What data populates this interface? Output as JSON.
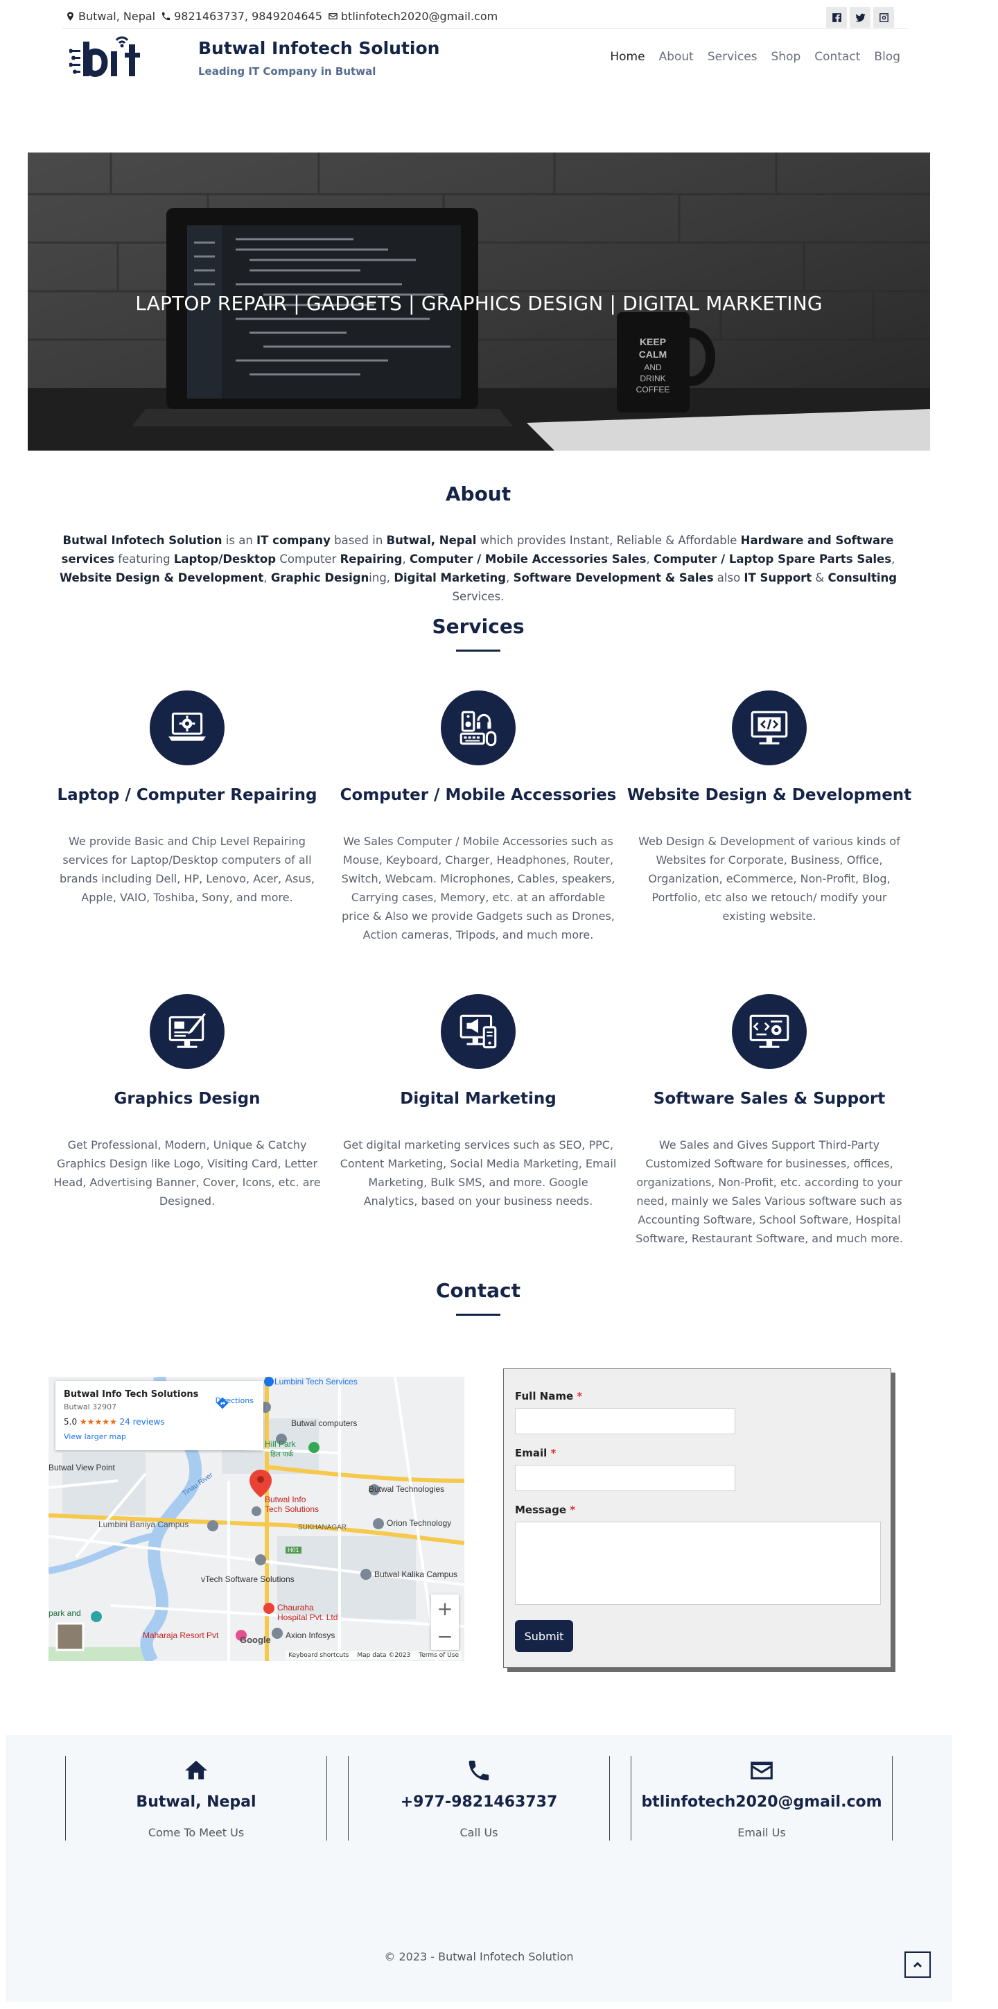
{
  "topbar": {
    "location": "Butwal, Nepal",
    "phones": "9821463737, 9849204645",
    "email": "btlinfotech2020@gmail.com",
    "social": [
      "facebook-icon",
      "twitter-icon",
      "instagram-icon"
    ]
  },
  "header": {
    "logo_text": "bit",
    "brand_name": "Butwal Infotech Solution",
    "tagline": "Leading IT Company in Butwal",
    "nav": [
      "Home",
      "About",
      "Services",
      "Shop",
      "Contact",
      "Blog"
    ],
    "active_nav": "Home"
  },
  "hero": {
    "caption": "LAPTOP REPAIR | GADGETS | GRAPHICS DESIGN | DIGITAL MARKETING",
    "mug_text": [
      "KEEP",
      "CALM",
      "AND",
      "DRINK",
      "COFFEE"
    ]
  },
  "about": {
    "heading": "About",
    "parts": [
      [
        "b",
        "Butwal Infotech Solution"
      ],
      [
        "t",
        " is an "
      ],
      [
        "b",
        "IT company"
      ],
      [
        "t",
        " based in "
      ],
      [
        "b",
        "Butwal, Nepal"
      ],
      [
        "t",
        " which provides Instant, Reliable & Affordable "
      ],
      [
        "b",
        "Hardware and Software services"
      ],
      [
        "t",
        " featuring "
      ],
      [
        "b",
        "Laptop/Desktop"
      ],
      [
        "t",
        " Computer "
      ],
      [
        "b",
        "Repairing"
      ],
      [
        "t",
        ", "
      ],
      [
        "b",
        "Computer / Mobile Accessories Sales"
      ],
      [
        "t",
        ", "
      ],
      [
        "b",
        "Computer / Laptop Spare Parts Sales"
      ],
      [
        "t",
        ", "
      ],
      [
        "b",
        "Website Design & Development"
      ],
      [
        "t",
        ", "
      ],
      [
        "b",
        "Graphic Design"
      ],
      [
        "t",
        "ing, "
      ],
      [
        "b",
        "Digital Marketing"
      ],
      [
        "t",
        ", "
      ],
      [
        "b",
        "Software Development & Sales"
      ],
      [
        "t",
        " also "
      ],
      [
        "b",
        "IT Support"
      ],
      [
        "t",
        " & "
      ],
      [
        "b",
        "Consulting"
      ],
      [
        "t",
        " Services."
      ]
    ]
  },
  "services": {
    "heading": "Services",
    "items": [
      {
        "icon": "laptop-gear-icon",
        "title": "Laptop / Computer Repairing",
        "desc": "We provide Basic and Chip Level Repairing services for Laptop/Desktop computers of all brands including Dell, HP, Lenovo, Acer, Asus, Apple, VAIO, Toshiba, Sony, and more."
      },
      {
        "icon": "accessories-icon",
        "title": "Computer / Mobile Accessories",
        "desc": "We Sales Computer / Mobile Accessories such as Mouse, Keyboard, Charger, Headphones, Router, Switch, Webcam. Microphones, Cables, speakers, Carrying cases, Memory, etc. at an affordable price & Also we provide Gadgets such as Drones, Action cameras, Tripods, and much more."
      },
      {
        "icon": "monitor-code-icon",
        "title": "Website Design & Development",
        "desc": "Web Design & Development of various kinds of Websites for Corporate, Business, Office, Organization, eCommerce, Non-Profit, Blog, Portfolio, etc also we retouch/ modify your existing website."
      },
      {
        "icon": "graphics-design-icon",
        "title": "Graphics Design",
        "desc": "Get Professional, Modern, Unique & Catchy Graphics Design like Logo, Visiting Card, Letter Head, Advertising Banner, Cover, Icons, etc. are Designed."
      },
      {
        "icon": "digital-marketing-icon",
        "title": "Digital Marketing",
        "desc": "Get digital marketing services such as SEO, PPC, Content Marketing, Social Media Marketing, Email Marketing, Bulk SMS, and more. Google Analytics, based on your business needs."
      },
      {
        "icon": "software-support-icon",
        "title": "Software Sales & Support",
        "desc": "We Sales and Gives Support Third-Party Customized Software for businesses, offices, organizations, Non-Profit, etc. according to your need, mainly we Sales Various software such as Accounting Software, School Software, Hospital Software, Restaurant Software, and much more."
      }
    ]
  },
  "contact": {
    "heading": "Contact",
    "map": {
      "card_title": "Butwal Info Tech Solutions",
      "card_address": "Butwal 32907",
      "rating": "5.0",
      "stars": "★★★★★",
      "reviews": "24 reviews",
      "larger_map": "View larger map",
      "directions": "Directions",
      "zoom_in": "+",
      "zoom_out": "−",
      "footer": [
        "Keyboard shortcuts",
        "Map data ©2023",
        "Terms of Use"
      ],
      "google": "Google",
      "places": [
        "Lumbini Tech Services",
        "Butwal computers",
        "Hill Park",
        "हिल पार्क",
        "Butwal Technologies",
        "Butwal Info",
        "Tech Solutions",
        "Orion Technology",
        "Lumbini Baniya Campus",
        "SUKHANAGAR",
        "Butwal Kalika Campus",
        "vTech Software Solutions",
        "Chauraha",
        "Hospital Pvt. Ltd",
        "Maharaja Resort Pvt",
        "Axion Infosys",
        "Tinau River",
        "Butwal View Point",
        "H01",
        "park and"
      ]
    },
    "form": {
      "full_name_label": "Full Name",
      "email_label": "Email",
      "message_label": "Message",
      "required_mark": "*",
      "submit_label": "Submit"
    }
  },
  "footer": {
    "cols": [
      {
        "icon": "home-icon",
        "title": "Butwal, Nepal",
        "sub": "Come To Meet Us"
      },
      {
        "icon": "phone-icon",
        "title": "+977-9821463737",
        "sub": "Call Us"
      },
      {
        "icon": "envelope-icon",
        "title": "btlinfotech2020@gmail.com",
        "sub": "Email Us"
      }
    ],
    "copyright": "© 2023 - Butwal Infotech Solution"
  },
  "colors": {
    "primary": "#152346",
    "accent_red": "#d33",
    "footer_bg": "#f5f8fb"
  }
}
